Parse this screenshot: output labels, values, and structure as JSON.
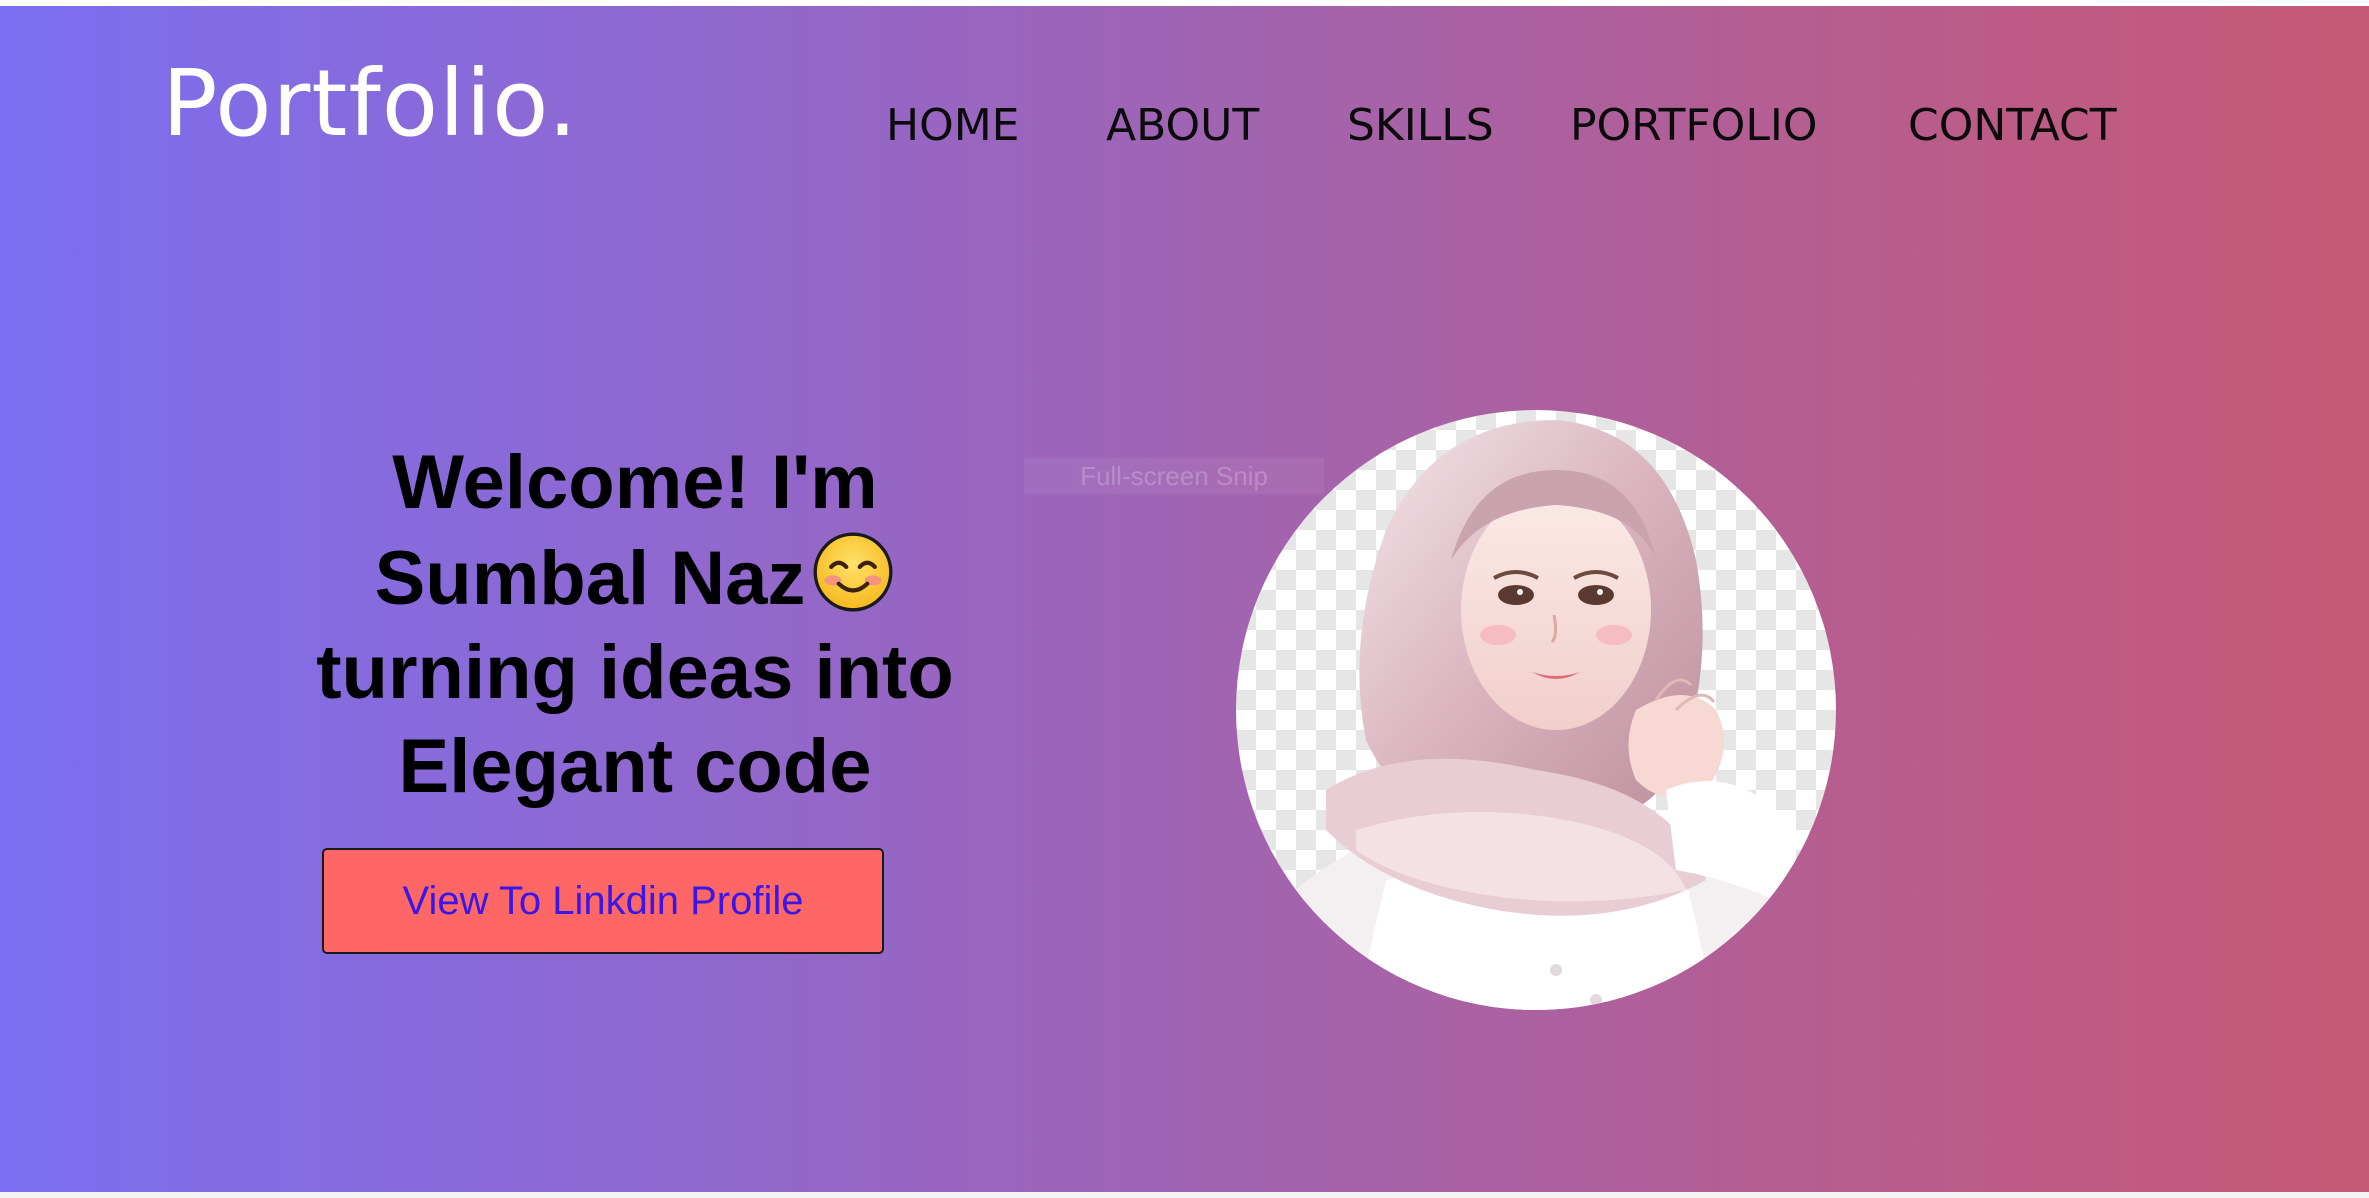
{
  "header": {
    "logo": "Portfolio."
  },
  "nav": {
    "items": [
      {
        "label": "HOME"
      },
      {
        "label": "ABOUT"
      },
      {
        "label": "SKILLS"
      },
      {
        "label": "PORTFOLIO"
      },
      {
        "label": "CONTACT"
      }
    ]
  },
  "hero": {
    "line1": "Welcome! I'm",
    "line2": "Sumbal Naz",
    "line3": "turning ideas into",
    "line4": "Elegant code",
    "emoji": "smiling-face-with-smiling-eyes-icon",
    "cta_label": "View To Linkdin Profile"
  },
  "overlay": {
    "snip_label": "Full-screen Snip"
  },
  "colors": {
    "gradient_start": "#7b6ef0",
    "gradient_end": "#c55a76",
    "button_bg": "#ff6767",
    "button_text": "#3a17e6",
    "logo_text": "#ffffff",
    "nav_text": "#0b0b0b"
  }
}
